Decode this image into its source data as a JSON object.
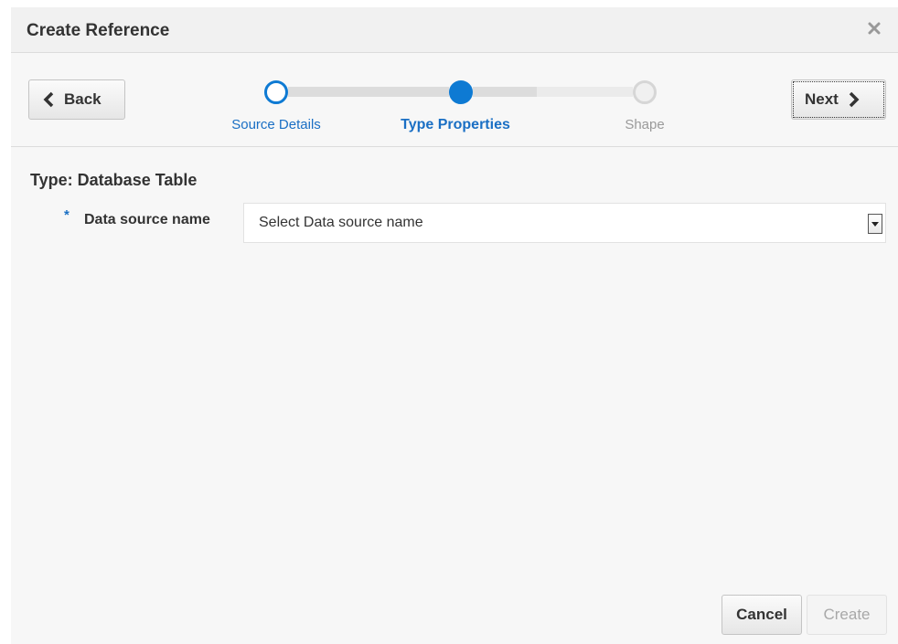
{
  "dialog": {
    "title": "Create Reference",
    "close_icon": "close-icon"
  },
  "navigation": {
    "back_label": "Back",
    "next_label": "Next",
    "back_icon": "chevron-left-icon",
    "next_icon": "chevron-right-icon"
  },
  "train": {
    "stops": [
      {
        "label": "Source Details",
        "state": "visited"
      },
      {
        "label": "Type Properties",
        "state": "current"
      },
      {
        "label": "Shape",
        "state": "unvisited"
      }
    ]
  },
  "form": {
    "section_title": "Type: Database Table",
    "required_marker": "*",
    "data_source": {
      "label": "Data source name",
      "value": "Select Data source name"
    }
  },
  "footer": {
    "cancel_label": "Cancel",
    "create_label": "Create"
  },
  "colors": {
    "accent": "#0e7ad3",
    "link": "#1a6fc4",
    "disabled_text": "#a8a8a8"
  }
}
